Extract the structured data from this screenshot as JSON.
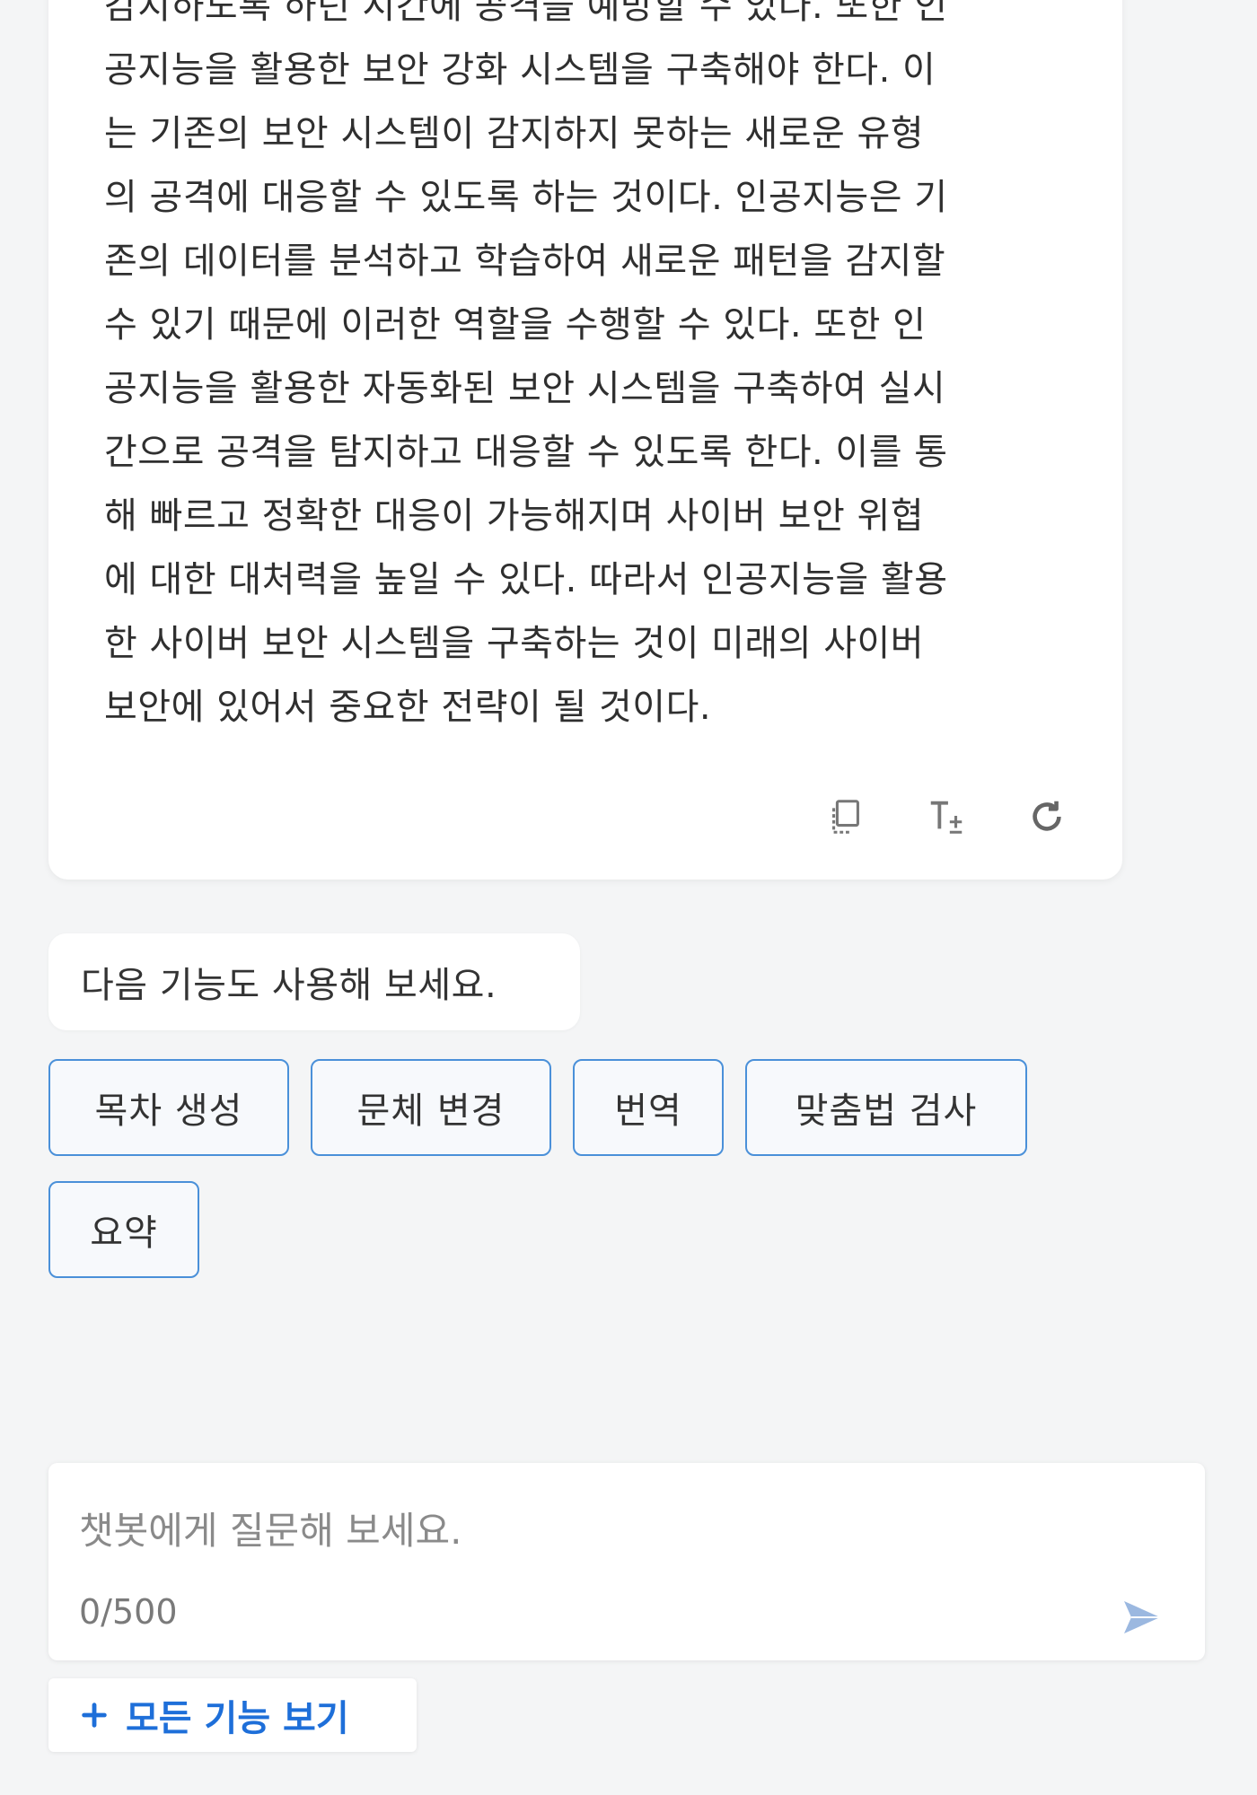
{
  "answer": {
    "lines": [
      "감지하도록 하던 시간에 공격을 예방할 수 있다. 또한 인",
      "공지능을 활용한 보안 강화 시스템을 구축해야 한다. 이",
      "는 기존의 보안 시스템이 감지하지 못하는 새로운 유형",
      "의 공격에 대응할 수 있도록 하는 것이다. 인공지능은 기",
      "존의 데이터를 분석하고 학습하여 새로운 패턴을 감지할",
      "수 있기 때문에 이러한 역할을 수행할 수 있다. 또한 인",
      "공지능을 활용한 자동화된 보안 시스템을 구축하여 실시",
      "간으로 공격을 탐지하고 대응할 수 있도록 한다. 이를 통",
      "해 빠르고 정확한 대응이 가능해지며 사이버 보안 위협",
      "에 대한 대처력을 높일 수 있다. 따라서 인공지능을 활용",
      "한 사이버 보안 시스템을 구축하는 것이 미래의 사이버",
      "보안에 있어서 중요한 전략이 될 것이다."
    ],
    "actions": {
      "copy_icon": "copy-icon",
      "text_size_icon": "text-size-icon",
      "regenerate_icon": "refresh-icon"
    }
  },
  "suggestion": {
    "prompt": "다음 기능도 사용해 보세요.",
    "chips": [
      "목차 생성",
      "문체 변경",
      "번역",
      "맞춤법 검사",
      "요약"
    ]
  },
  "composer": {
    "placeholder": "챗봇에게 질문해 보세요.",
    "value": "",
    "char_count": "0/500",
    "send_icon": "send-icon"
  },
  "all_features": {
    "label": "모든 기능 보기",
    "icon": "plus-icon"
  },
  "colors": {
    "accent": "#1e6fd9",
    "chip_border": "#4a90d9",
    "background": "#f4f5f6"
  }
}
